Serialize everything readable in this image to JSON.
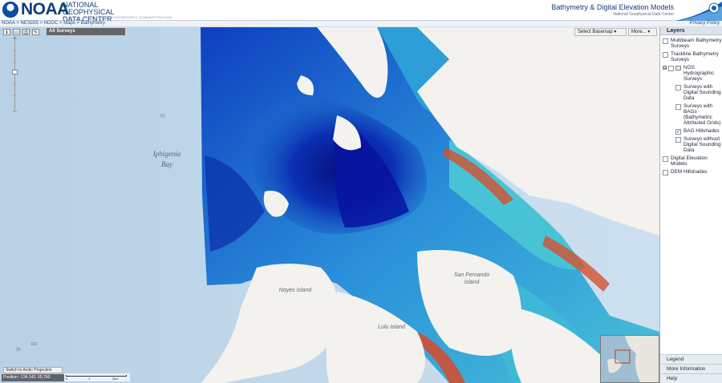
{
  "header": {
    "logo_text": "NOAA",
    "org_title": "NATIONAL GEOPHYSICAL DATA CENTER",
    "org_subtitle": "NATIONAL OCEANIC AND ATMOSPHERIC ADMINISTRATION",
    "app_title": "Bathymetry & Digital Elevation Models",
    "app_subtitle": "National Geophysical Data Center"
  },
  "breadcrumb": "NOAA > NESDIS > NGDC > Maps > Bathymetry",
  "privacy_link": "Privacy Policy",
  "map": {
    "toolbar": [
      {
        "name": "identify-icon",
        "glyph": "ℹ"
      },
      {
        "name": "measure-icon",
        "glyph": "▭"
      },
      {
        "name": "print-icon",
        "glyph": "⎙"
      },
      {
        "name": "clear-icon",
        "glyph": "✎"
      }
    ],
    "active_layer_label": "All Surveys",
    "basemap_button": "Select Basemap ▾",
    "more_button": "More... ▾",
    "place_labels": {
      "bay_line1": "Iphigenia",
      "bay_line2": "Bay",
      "noyes": "Noyes Island",
      "lulu": "Lulu Island",
      "san_fernando_line1": "San Fernando",
      "san_fernando_line2": "Island"
    },
    "depth_labels": [
      "51",
      "25",
      "163"
    ],
    "projection_button": "Switch to Arctic Projection",
    "position_readout": "Position: -134.142, 55.760",
    "scale": {
      "labels": [
        "0",
        "1",
        "2km"
      ]
    },
    "colors": {
      "ocean": "#b9d4e8",
      "land": "#f2f2ef",
      "deep": "#071a8c",
      "mid": "#1f7fd0",
      "shallow": "#4fc8d8",
      "shoal": "#d84a2a"
    }
  },
  "layers_panel": {
    "title": "Layers",
    "items": [
      {
        "label": "Multibeam Bathymetry Surveys",
        "checked": false,
        "indent": 0
      },
      {
        "label": "Trackline Bathymetry Surveys",
        "checked": false,
        "indent": 0
      },
      {
        "label": "NOS Hydrographic Surveys",
        "checked": false,
        "indent": 0,
        "group": true,
        "expander": "⊟"
      },
      {
        "label": "Surveys with Digital Sounding Data",
        "checked": false,
        "indent": 1
      },
      {
        "label": "Surveys with BAGs (Bathymetric Attributed Grids)",
        "checked": false,
        "indent": 1
      },
      {
        "label": "BAG Hillshades",
        "checked": true,
        "indent": 1
      },
      {
        "label": "Surveys without Digital Sounding Data",
        "checked": false,
        "indent": 1
      },
      {
        "label": "Digital Elevation Models",
        "checked": false,
        "indent": 0
      },
      {
        "label": "DEM Hillshades",
        "checked": false,
        "indent": 0
      }
    ],
    "footer": [
      "Legend",
      "More Information",
      "Help"
    ]
  }
}
